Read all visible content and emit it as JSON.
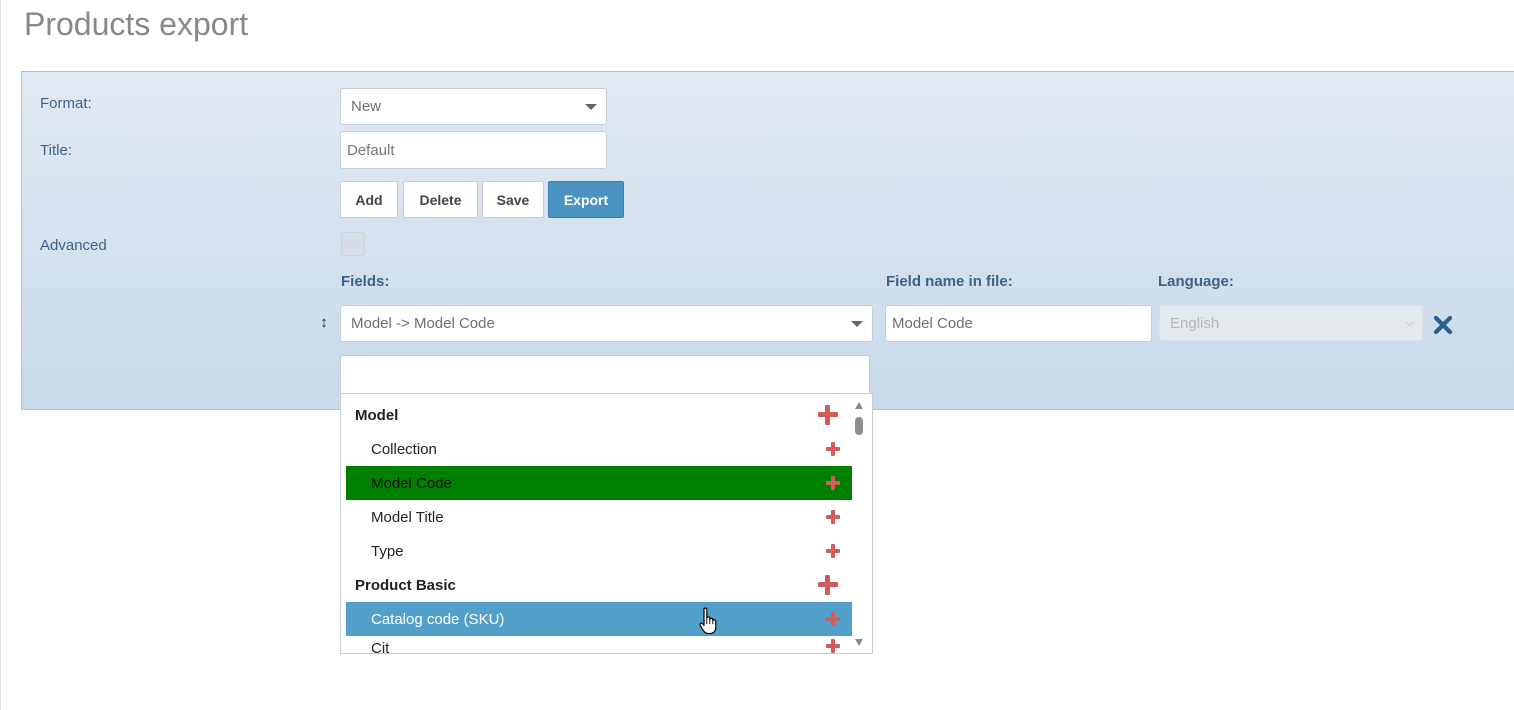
{
  "page": {
    "title": "Products export"
  },
  "form": {
    "format_label": "Format:",
    "format_value": "New",
    "title_label": "Title:",
    "title_placeholder": "Default",
    "buttons": {
      "add": "Add",
      "delete": "Delete",
      "save": "Save",
      "export": "Export"
    },
    "advanced_label": "Advanced",
    "advanced_checked": false
  },
  "fields_section": {
    "fields_header": "Fields:",
    "field_name_header": "Field name in file:",
    "language_header": "Language:",
    "field_value": "Model -> Model Code",
    "field_name_value": "Model Code",
    "language_value": "English",
    "language_disabled": true
  },
  "dropdown": {
    "search_value": "",
    "items": [
      {
        "label": "Model",
        "kind": "group"
      },
      {
        "label": "Collection",
        "kind": "child"
      },
      {
        "label": "Model Code",
        "kind": "child",
        "state": "current"
      },
      {
        "label": "Model Title",
        "kind": "child"
      },
      {
        "label": "Type",
        "kind": "child"
      },
      {
        "label": "Product Basic",
        "kind": "group"
      },
      {
        "label": "Catalog code (SKU)",
        "kind": "child",
        "state": "hover"
      },
      {
        "label": "Cit",
        "kind": "child",
        "partial": true
      }
    ]
  },
  "colors": {
    "panel_top": "#e2eaf3",
    "panel_bottom": "#c8d9ea",
    "label_text": "#3c6288",
    "primary_button": "#4a94c4",
    "current_item": "#008000",
    "hover_item": "#529fca",
    "add_icon": "#d05c5c",
    "remove_icon": "#2a5f8e"
  }
}
